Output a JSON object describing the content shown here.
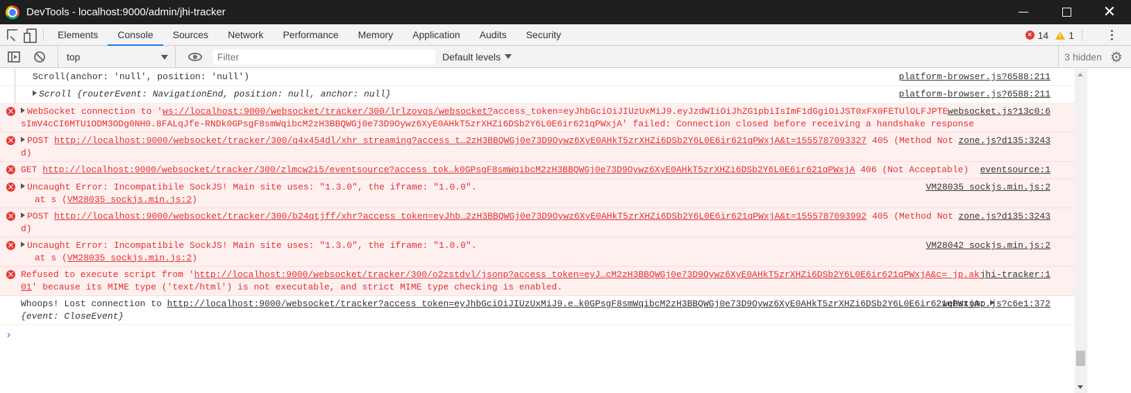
{
  "window": {
    "title": "DevTools - localhost:9000/admin/jhi-tracker"
  },
  "tabs": [
    "Elements",
    "Console",
    "Sources",
    "Network",
    "Performance",
    "Memory",
    "Application",
    "Audits",
    "Security"
  ],
  "active_tab": "Console",
  "counts": {
    "errors": "14",
    "warnings": "1"
  },
  "toolbar": {
    "context": "top",
    "filter_placeholder": "Filter",
    "levels": "Default levels",
    "hidden": "3 hidden"
  },
  "messages": [
    {
      "type": "log",
      "group": true,
      "text": "Scroll(anchor: 'null', position: 'null')",
      "source": "platform-browser.js?6588:211"
    },
    {
      "type": "log",
      "group": true,
      "text": "Scroll {routerEvent: NavigationEnd, position: null, anchor: null}",
      "source": "platform-browser.js?6588:211"
    },
    {
      "type": "error",
      "prefix": "WebSocket connection to '",
      "link": "ws://localhost:9000/websocket/tracker/300/lrlzovos/websocket?",
      "text": "access_token=eyJhbGciOiJIUzUxMiJ9.eyJzdWIiOiJhZG1pbiIsImF1dGgiOiJST0xFX0FETUlOLFJPTEVfVVNFUiIsImV4cCI6MTU1ODM3ODg0NH0.8FALqJfe-RNDk0GPsgF8smWqibcM2zH3BBQWGj0e73D9Oywz6XyE0AHkT5zrXHZi6DSb2Y6L0E6ir621qPWxjA' failed: Connection closed before receiving a handshake response",
      "source": "websocket.js?13c0:6"
    },
    {
      "type": "error",
      "prefix": "POST ",
      "link": "http://localhost:9000/websocket/tracker/300/q4x454dl/xhr_streaming?access_t…2zH3BBQWGj0e73D9Oywz6XyE0AHkT5zrXHZi6DSb2Y6L0E6ir621qPWxjA&t=1555787093327",
      "text": " 405 (Method Not Allowed)",
      "source": "zone.js?d135:3243"
    },
    {
      "type": "error",
      "prefix": "GET ",
      "link": "http://localhost:9000/websocket/tracker/300/zlmcw2i5/eventsource?access_tok…k0GPsgF8smWqibcM2zH3BBQWGj0e73D9Oywz6XyE0AHkT5zrXHZi6DSb2Y6L0E6ir621qPWxjA",
      "text": " 406 (Not Acceptable)",
      "source": "eventsource:1"
    },
    {
      "type": "error",
      "prefix": "Uncaught Error: Incompatibile SockJS! Main site uses: \"1.3.0\", the iframe: \"1.0.0\".",
      "stack_pre": "at s (",
      "stack_link": "VM28035 sockjs.min.js:2",
      "stack_post": ")",
      "source": "VM28035 sockjs.min.js:2"
    },
    {
      "type": "error",
      "prefix": "POST ",
      "link": "http://localhost:9000/websocket/tracker/300/b24qtjff/xhr?access_token=eyJhb…2zH3BBQWGj0e73D9Oywz6XyE0AHkT5zrXHZi6DSb2Y6L0E6ir621qPWxjA&t=1555787093992",
      "text": " 405 (Method Not Allowed)",
      "source": "zone.js?d135:3243"
    },
    {
      "type": "error",
      "prefix": "Uncaught Error: Incompatibile SockJS! Main site uses: \"1.3.0\", the iframe: \"1.0.0\".",
      "stack_pre": "at s (",
      "stack_link": "VM28035 sockjs.min.js:2",
      "stack_post": ")",
      "source": "VM28042 sockjs.min.js:2"
    },
    {
      "type": "error",
      "prefix": "Refused to execute script from '",
      "link": "http://localhost:9000/websocket/tracker/300/o2zstdvl/jsonp?access_token=eyJ…cM2zH3BBQWGj0e73D9Oywz6XyE0AHkT5zrXHZi6DSb2Y6L0E6ir621qPWxjA&c=_jp.aknsu01",
      "text": "' because its MIME type ('text/html') is not executable, and strict MIME type checking is enabled.",
      "source": "jhi-tracker:1"
    },
    {
      "type": "log",
      "prefix": "Whoops! Lost connection to ",
      "link": "http://localhost:9000/websocket/tracker?access_token=eyJhbGciOiJIUzUxMiJ9.e…k0GPsgF8smWqibcM2zH3BBQWGj0e73D9Oywz6XyE0AHkT5zrXHZi6DSb2Y6L0E6ir621qPWxjA",
      "text": ": ",
      "obj": "{event: CloseEvent}",
      "source": "webstomp.js?c6e1:372"
    }
  ],
  "prompt_symbol": "›"
}
